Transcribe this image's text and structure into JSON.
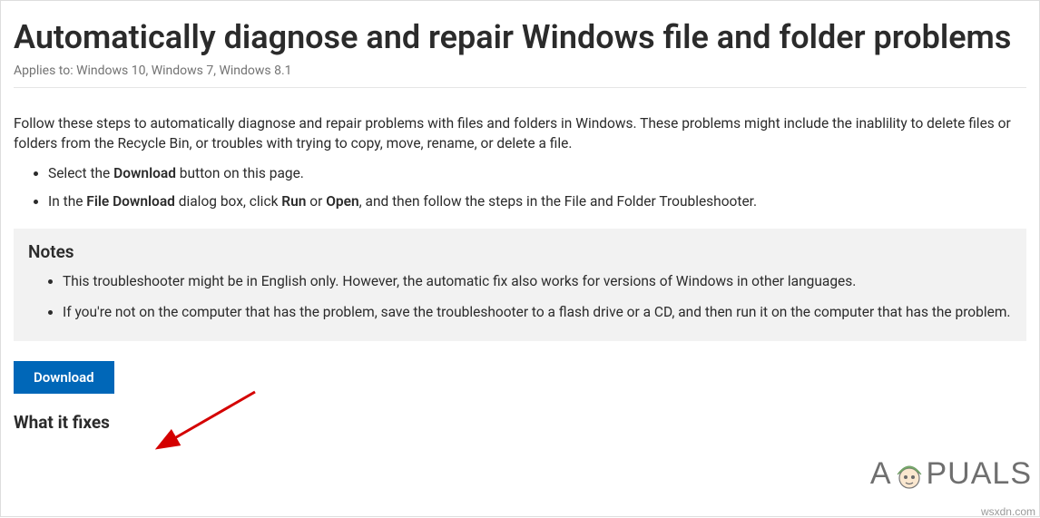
{
  "header": {
    "title": "Automatically diagnose and repair Windows file and folder problems",
    "applies_to": "Applies to: Windows 10, Windows 7, Windows 8.1"
  },
  "intro": "Follow these steps to automatically diagnose and repair problems with files and folders in Windows. These problems might include the inablility to delete files or folders from the Recycle Bin, or troubles with trying to copy, move, rename, or delete a file.",
  "steps": {
    "step1_pre": "Select the ",
    "step1_bold": "Download",
    "step1_post": " button on this page.",
    "step2_pre": "In the ",
    "step2_bold1": "File Download",
    "step2_mid": " dialog box, click ",
    "step2_bold2": "Run",
    "step2_or": " or ",
    "step2_bold3": "Open",
    "step2_post": ", and then follow the steps in the File and Folder Troubleshooter."
  },
  "notes": {
    "title": "Notes",
    "item1": "This troubleshooter might be in English only. However, the automatic fix also works for versions of Windows in other languages.",
    "item2": "If you're not on the computer that has the problem, save the troubleshooter to a flash drive or a CD, and then run it on the computer that has the problem."
  },
  "download_button": "Download",
  "section_heading": "What it fixes",
  "watermark": {
    "left": "A",
    "right": "PUALS"
  },
  "credit": "wsxdn.com"
}
